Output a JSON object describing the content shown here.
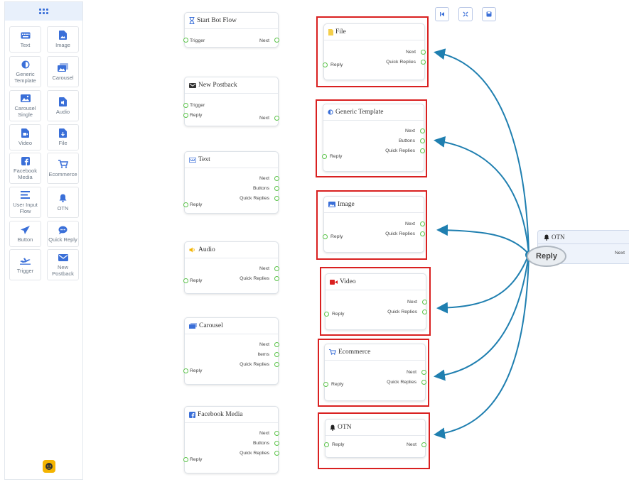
{
  "sidebar": {
    "items": [
      {
        "label": "Text",
        "icon": "keyboard-icon"
      },
      {
        "label": "Image",
        "icon": "image-file-icon"
      },
      {
        "label": "Generic Template",
        "icon": "half-circle-icon"
      },
      {
        "label": "Carousel",
        "icon": "gallery-icon"
      },
      {
        "label": "Carousel Single",
        "icon": "picture-icon"
      },
      {
        "label": "Audio",
        "icon": "audio-file-icon"
      },
      {
        "label": "Video",
        "icon": "video-file-icon"
      },
      {
        "label": "File",
        "icon": "file-icon"
      },
      {
        "label": "Facebook Media",
        "icon": "facebook-icon"
      },
      {
        "label": "Ecommerce",
        "icon": "cart-icon"
      },
      {
        "label": "User Input Flow",
        "icon": "lines-icon"
      },
      {
        "label": "OTN",
        "icon": "bell-icon"
      },
      {
        "label": "Button",
        "icon": "paper-plane-icon"
      },
      {
        "label": "Quick Reply",
        "icon": "chat-icon"
      },
      {
        "label": "Trigger",
        "icon": "plane-icon"
      },
      {
        "label": "New Postback",
        "icon": "envelope-icon"
      }
    ]
  },
  "toolbar": {
    "buttons": [
      "previous-icon",
      "collapse-icon",
      "save-icon"
    ]
  },
  "colors": {
    "accent": "#3a6fd8",
    "highlight": "#d92020",
    "connector": "#1f7fb0",
    "port": "#5bc34a"
  },
  "left_nodes": [
    {
      "title": "Start Bot Flow",
      "inputs": [
        "Trigger"
      ],
      "outputs": [
        "Next"
      ]
    },
    {
      "title": "New Postback",
      "inputs": [
        "Trigger",
        "Reply"
      ],
      "outputs": [
        "Next"
      ]
    },
    {
      "title": "Text",
      "inputs": [
        "Reply"
      ],
      "outputs": [
        "Next",
        "Buttons",
        "Quick Replies"
      ]
    },
    {
      "title": "Audio",
      "inputs": [
        "Reply"
      ],
      "outputs": [
        "Next",
        "Quick Replies"
      ]
    },
    {
      "title": "Carousel",
      "inputs": [
        "Reply"
      ],
      "outputs": [
        "Next",
        "Items",
        "Quick Replies"
      ]
    },
    {
      "title": "Facebook Media",
      "inputs": [
        "Reply"
      ],
      "outputs": [
        "Next",
        "Buttons",
        "Quick Replies"
      ]
    }
  ],
  "right_nodes": [
    {
      "title": "File",
      "inputs": [
        "Reply"
      ],
      "outputs": [
        "Next",
        "Quick Replies"
      ]
    },
    {
      "title": "Generic Template",
      "inputs": [
        "Reply"
      ],
      "outputs": [
        "Next",
        "Buttons",
        "Quick Replies"
      ]
    },
    {
      "title": "Image",
      "inputs": [
        "Reply"
      ],
      "outputs": [
        "Next",
        "Quick Replies"
      ]
    },
    {
      "title": "Video",
      "inputs": [
        "Reply"
      ],
      "outputs": [
        "Next",
        "Quick Replies"
      ]
    },
    {
      "title": "Ecommerce",
      "inputs": [
        "Reply"
      ],
      "outputs": [
        "Next",
        "Quick Replies"
      ]
    },
    {
      "title": "OTN",
      "inputs": [
        "Reply"
      ],
      "outputs": [
        "Next"
      ]
    }
  ],
  "otn_node": {
    "title": "OTN",
    "reply": "Reply",
    "next": "Next"
  }
}
